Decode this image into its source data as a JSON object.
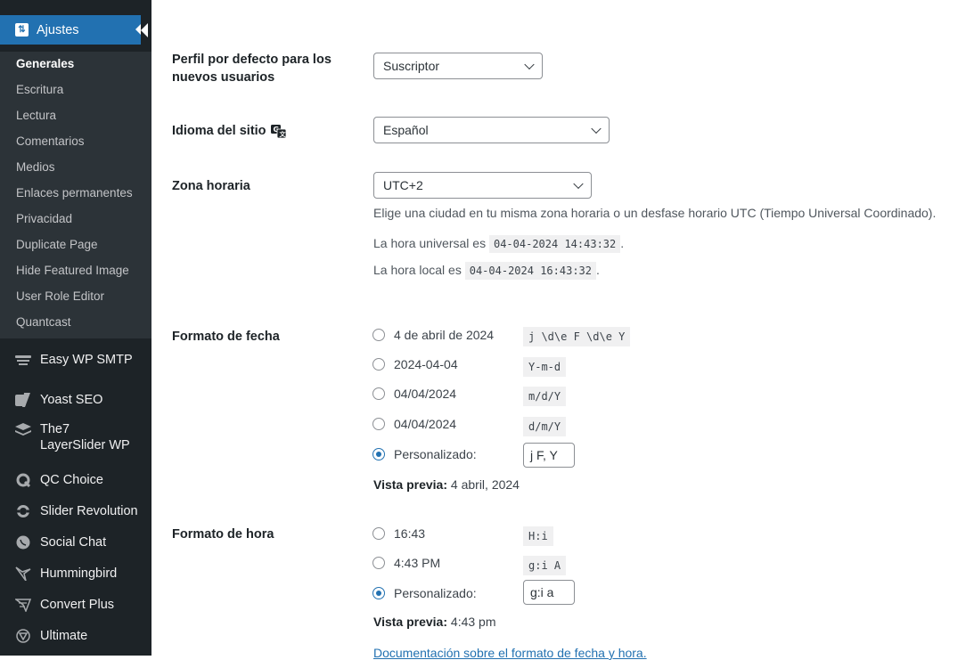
{
  "sidebar": {
    "active": {
      "label": "Ajustes",
      "icon": "settings-icon"
    },
    "submenu": [
      {
        "label": "Generales",
        "current": true
      },
      {
        "label": "Escritura"
      },
      {
        "label": "Lectura"
      },
      {
        "label": "Comentarios"
      },
      {
        "label": "Medios"
      },
      {
        "label": "Enlaces permanentes"
      },
      {
        "label": "Privacidad"
      },
      {
        "label": "Duplicate Page"
      },
      {
        "label": "Hide Featured Image"
      },
      {
        "label": "User Role Editor"
      },
      {
        "label": "Quantcast"
      }
    ],
    "menu": [
      {
        "label": "Easy WP SMTP",
        "icon": "smtp-icon"
      },
      {
        "label": "Yoast SEO",
        "icon": "yoast-icon"
      },
      {
        "label": "The7 LayerSlider WP",
        "icon": "layers-icon"
      },
      {
        "label": "QC Choice",
        "icon": "qc-icon"
      },
      {
        "label": "Slider Revolution",
        "icon": "revolution-icon"
      },
      {
        "label": "Social Chat",
        "icon": "chat-icon"
      },
      {
        "label": "Hummingbird",
        "icon": "hummingbird-icon"
      },
      {
        "label": "Convert Plus",
        "icon": "convert-plus-icon"
      },
      {
        "label": "Ultimate",
        "icon": "ultimate-icon"
      }
    ]
  },
  "main": {
    "default_role": {
      "label": "Perfil por defecto para los nuevos usuarios",
      "value": "Suscriptor"
    },
    "site_language": {
      "label": "Idioma del sitio",
      "value": "Español"
    },
    "timezone": {
      "label": "Zona horaria",
      "value": "UTC+2",
      "description": "Elige una ciudad en tu misma zona horaria o un desfase horario UTC (Tiempo Universal Coordinado).",
      "utc_prefix": "La hora universal es",
      "utc_time": "04-04-2024 14:43:32",
      "local_prefix": "La hora local es",
      "local_time": "04-04-2024 16:43:32",
      "suffix": "."
    },
    "date_format": {
      "label": "Formato de fecha",
      "options": [
        {
          "label": "4 de abril de 2024",
          "format": "j \\d\\e F \\d\\e Y",
          "selected": false
        },
        {
          "label": "2024-04-04",
          "format": "Y-m-d",
          "selected": false
        },
        {
          "label": "04/04/2024",
          "format": "m/d/Y",
          "selected": false
        },
        {
          "label": "04/04/2024",
          "format": "d/m/Y",
          "selected": false
        },
        {
          "label": "Personalizado:",
          "custom_value": "j F, Y",
          "selected": true
        }
      ],
      "preview_label": "Vista previa:",
      "preview_value": "4 abril, 2024"
    },
    "time_format": {
      "label": "Formato de hora",
      "options": [
        {
          "label": "16:43",
          "format": "H:i",
          "selected": false
        },
        {
          "label": "4:43 PM",
          "format": "g:i A",
          "selected": false
        },
        {
          "label": "Personalizado:",
          "custom_value": "g:i a",
          "selected": true
        }
      ],
      "preview_label": "Vista previa:",
      "preview_value": "4:43 pm"
    },
    "doc_link": "Documentación sobre el formato de fecha y hora."
  }
}
